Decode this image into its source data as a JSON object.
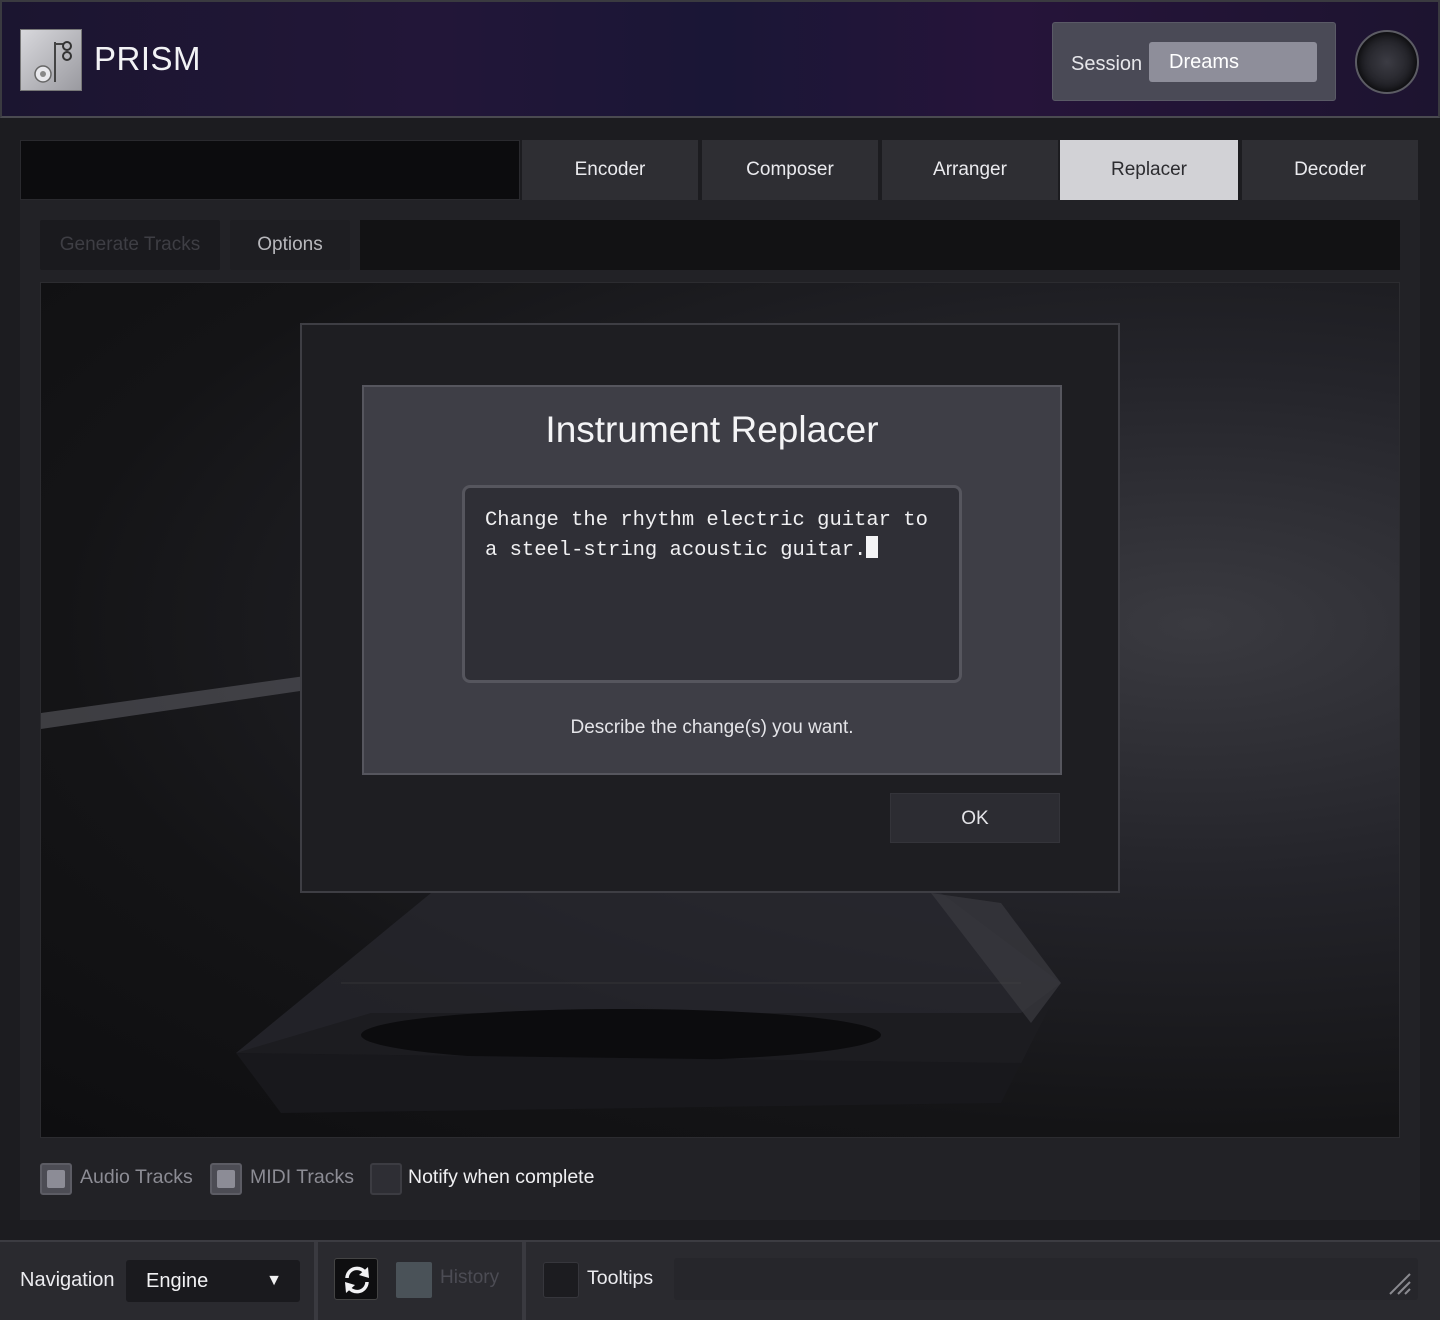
{
  "app": {
    "title": "PRISM"
  },
  "session": {
    "label": "Session",
    "value": "Dreams"
  },
  "tabs": [
    {
      "label": "Encoder",
      "active": false
    },
    {
      "label": "Composer",
      "active": false
    },
    {
      "label": "Arranger",
      "active": false
    },
    {
      "label": "Replacer",
      "active": true
    },
    {
      "label": "Decoder",
      "active": false
    }
  ],
  "toolbar": {
    "generate_label": "Generate Tracks",
    "options_label": "Options"
  },
  "dialog": {
    "title": "Instrument Replacer",
    "text": "Change the rhythm electric guitar to a steel-string acoustic guitar.",
    "hint": "Describe the change(s) you want.",
    "ok_label": "OK"
  },
  "options": {
    "audio_tracks": "Audio Tracks",
    "midi_tracks": "MIDI Tracks",
    "notify": "Notify when complete"
  },
  "bottom_bar": {
    "navigation_label": "Navigation",
    "navigation_value": "Engine",
    "history_label": "History",
    "tooltips_label": "Tooltips"
  },
  "icons": {
    "logo": "tuning-fork-logo-icon",
    "power": "power-knob-icon",
    "dropdown": "triangle-down-icon",
    "refresh": "refresh-icon",
    "resize": "resize-grip-icon"
  },
  "colors": {
    "active_tab": "#d2d2d6",
    "session_value_bg": "#8e8e9a",
    "dialog_bg": "#3e3e46"
  }
}
